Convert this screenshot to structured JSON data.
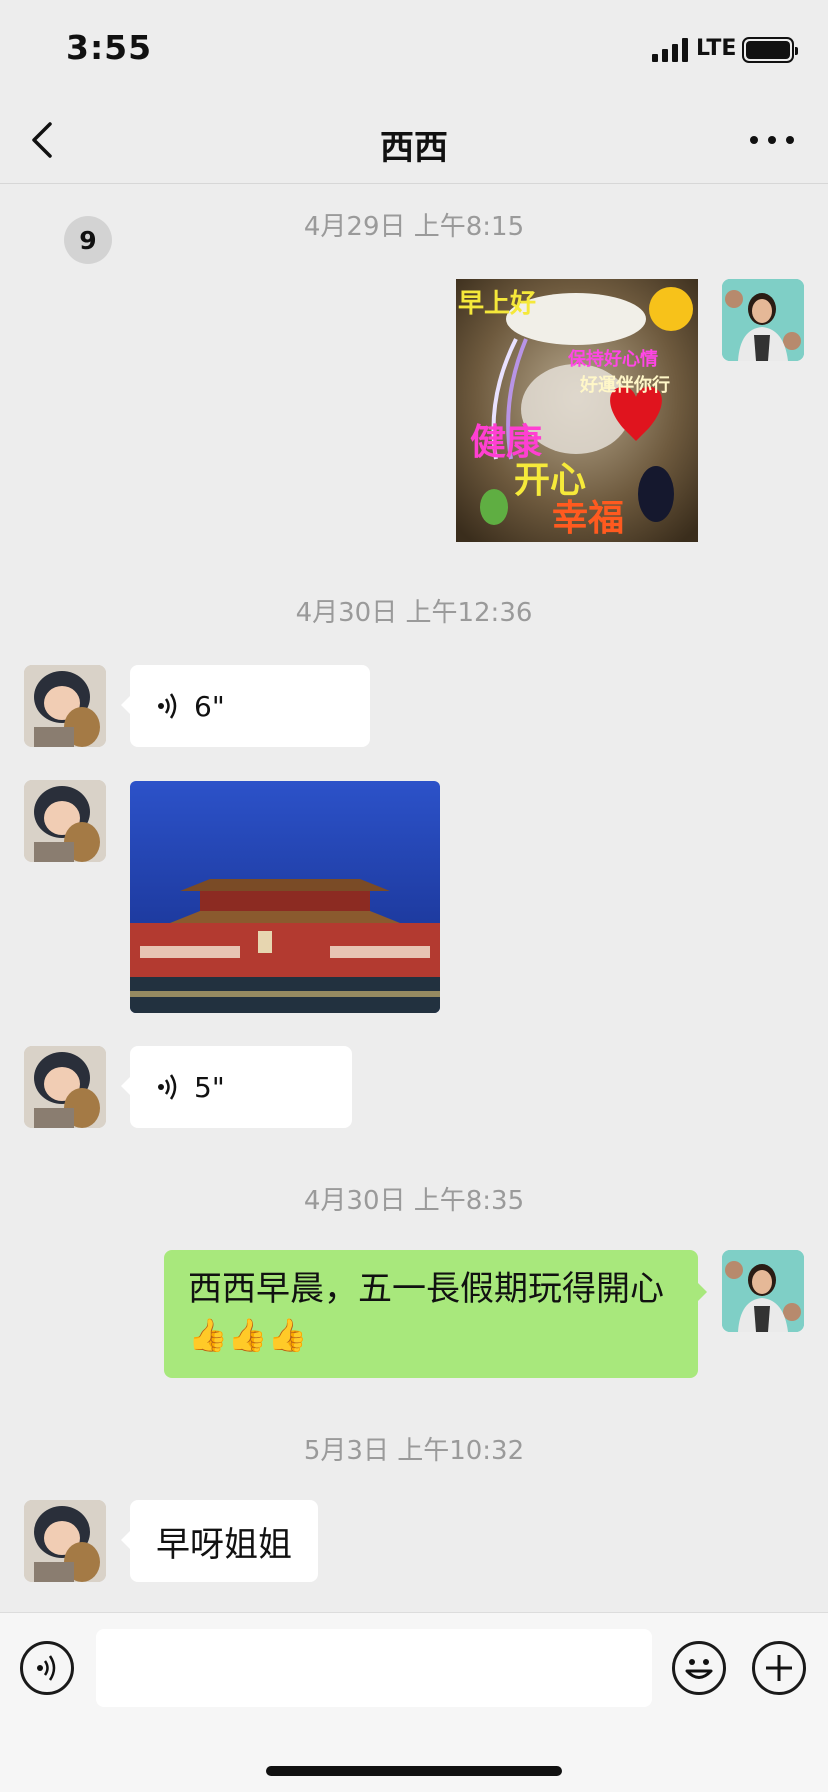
{
  "status": {
    "time": "3:55",
    "network": "LTE"
  },
  "nav": {
    "back_count": "9",
    "title": "西西"
  },
  "messages": {
    "ts1": "4月29日 上午8:15",
    "img1_text": {
      "l1": "早上好",
      "l2": "保持好心情",
      "l3": "好運伴你行",
      "l4": "健康",
      "l5": "开心",
      "l6": "幸福"
    },
    "ts2": "4月30日 上午12:36",
    "voice1": "6\"",
    "voice2": "5\"",
    "ts3": "4月30日 上午8:35",
    "green_text": "西西早晨，五一長假期玩得開心",
    "green_emoji": "👍👍👍",
    "ts4": "5月3日 上午10:32",
    "last_text": "早呀姐姐"
  },
  "colors": {
    "background": "#ededed",
    "sent_bubble": "#a8e87c",
    "received_bubble": "#ffffff",
    "timestamp": "#9a9a9a"
  }
}
